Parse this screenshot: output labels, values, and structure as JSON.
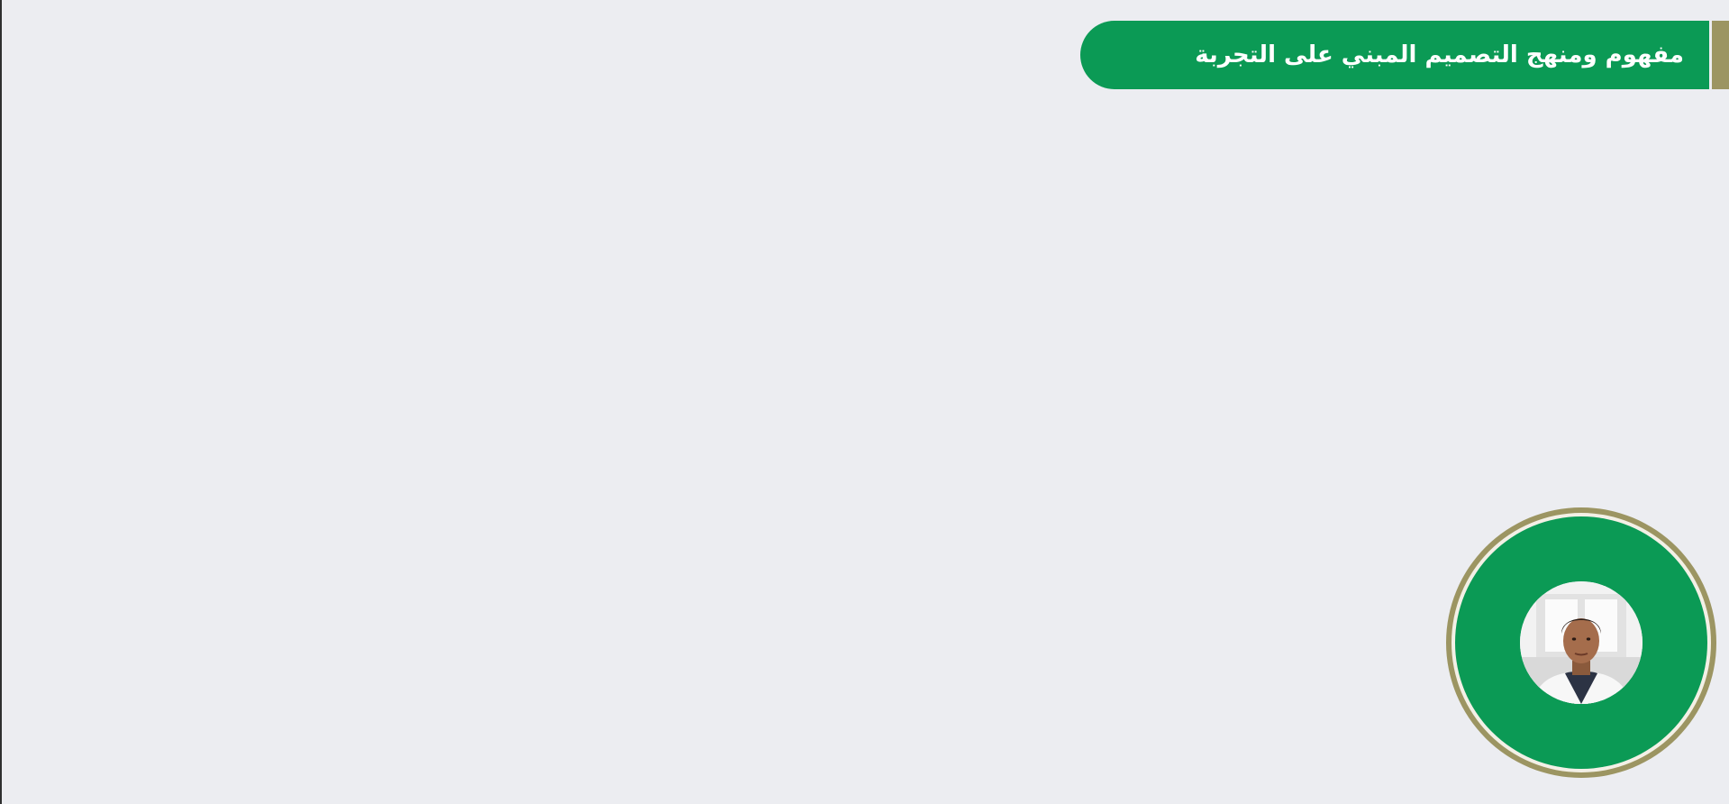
{
  "header": {
    "title": "مفهوم ومنهج التصميم المبني على التجربة"
  },
  "presenter": {
    "icon": "presenter-avatar-icon"
  },
  "colors": {
    "background": "#ecedf1",
    "brand_green": "#0b9a55",
    "accent_gold": "#9c9562"
  }
}
